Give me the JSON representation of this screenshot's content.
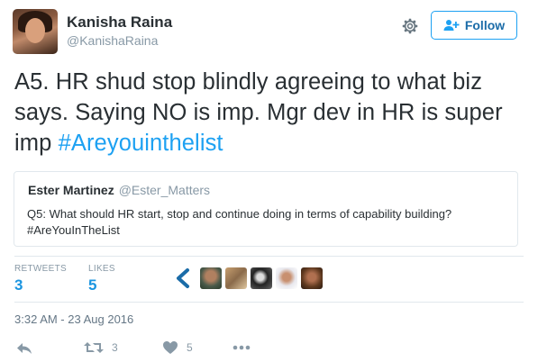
{
  "user": {
    "name": "Kanisha Raina",
    "handle": "@KanishaRaina"
  },
  "header": {
    "follow_label": "Follow"
  },
  "tweet": {
    "text": "A5. HR shud stop blindly agreeing to what biz says. Saying NO is imp. Mgr dev in HR is super imp ",
    "hashtag": "#Areyouinthelist"
  },
  "quoted": {
    "name": "Ester Martinez",
    "handle": "@Ester_Matters",
    "text_line1": "Q5: What should HR start, stop and continue doing in terms of capability building?",
    "text_line2": "#AreYouInTheList"
  },
  "stats": {
    "retweets_label": "RETWEETS",
    "retweets_value": "3",
    "likes_label": "LIKES",
    "likes_value": "5"
  },
  "timestamp": "3:32 AM - 23 Aug 2016",
  "actions": {
    "retweet_count": "3",
    "like_count": "5"
  },
  "colors": {
    "accent": "#1da1f2",
    "text": "#292f33",
    "muted": "#8899a6"
  }
}
